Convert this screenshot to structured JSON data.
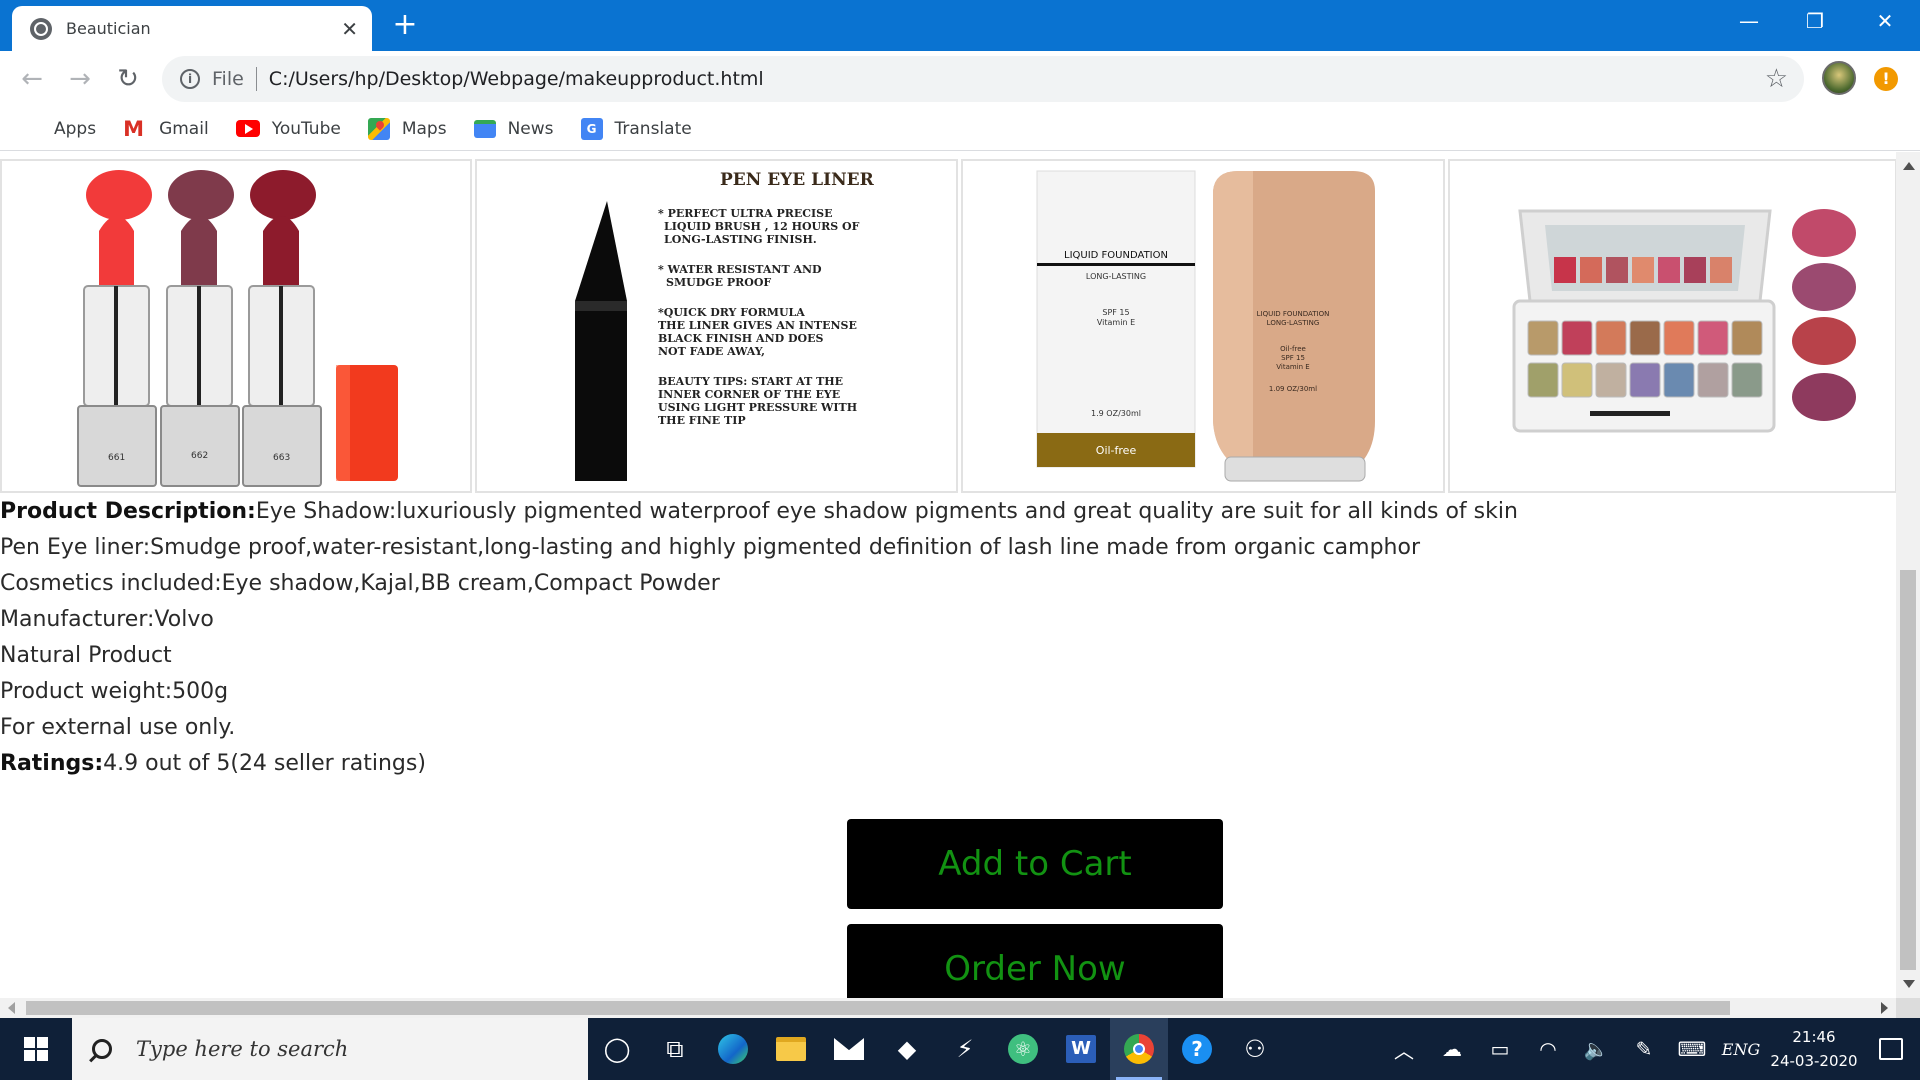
{
  "browser": {
    "tab_title": "Beautician",
    "tab_close": "✕",
    "new_tab": "+",
    "window_controls": {
      "minimize": "—",
      "restore": "❐",
      "close": "✕"
    },
    "nav": {
      "back": "←",
      "forward": "→",
      "reload": "↻"
    },
    "omnibox": {
      "info": "i",
      "scheme_label": "File",
      "url": "C:/Users/hp/Desktop/Webpage/makeupproduct.html",
      "star": "☆"
    },
    "alert": "!",
    "bookmarks": [
      {
        "label": "Apps",
        "icon": "apps-grid-icon"
      },
      {
        "label": "Gmail",
        "icon": "gmail-icon"
      },
      {
        "label": "YouTube",
        "icon": "youtube-icon"
      },
      {
        "label": "Maps",
        "icon": "maps-icon"
      },
      {
        "label": "News",
        "icon": "news-icon"
      },
      {
        "label": "Translate",
        "icon": "translate-icon"
      }
    ]
  },
  "products": {
    "lipsticks": {
      "shades": [
        "661",
        "662",
        "663"
      ],
      "colors": [
        "#f23a3a",
        "#7f3a4b",
        "#8d1b2c"
      ]
    },
    "eyeliner": {
      "title": "PEN EYE LINER",
      "points": [
        "* PERFECT ULTRA PRECISE",
        "LIQUID BRUSH , 12 HOURS OF",
        "LONG-LASTING FINISH.",
        "* WATER RESISTANT AND",
        "SMUDGE PROOF",
        "*QUICK DRY FORMULA",
        "THE LINER GIVES AN INTENSE",
        "BLACK FINISH AND DOES",
        "NOT FADE AWAY,",
        "BEAUTY TIPS: START AT THE",
        "INNER CORNER OF THE EYE",
        "USING LIGHT PRESSURE WITH",
        "THE FINE TIP"
      ]
    },
    "foundation": {
      "box_title": "LIQUID FOUNDATION",
      "box_sub": "LONG-LASTING",
      "box_spf": "SPF 15",
      "box_vit": "Vitamin E",
      "box_size": "1.9 OZ/30ml",
      "box_band": "Oil-free",
      "tube_title": "LIQUID FOUNDATION",
      "tube_sub": "LONG-LASTING",
      "tube_l1": "Oil-free",
      "tube_l2": "SPF 15",
      "tube_l3": "Vitamin E",
      "tube_size": "1.09 OZ/30ml"
    }
  },
  "description": {
    "label": "Product Description:",
    "eyeshadow": "Eye Shadow:luxuriously pigmented waterproof eye shadow pigments and great quality are suit for all kinds of skin",
    "eyeliner": "Pen Eye liner:Smudge proof,water-resistant,long-lasting and highly pigmented definition of lash line made from organic camphor",
    "cosmetics": "Cosmetics included:Eye shadow,Kajal,BB cream,Compact Powder",
    "manufacturer": "Manufacturer:Volvo",
    "natural": "Natural Product",
    "weight": "Product weight:500g",
    "external": "For external use only.",
    "ratings_label": "Ratings:",
    "ratings_value": "4.9 out of 5(24 seller ratings)"
  },
  "actions": {
    "add_to_cart": "Add to Cart",
    "order_now": "Order Now"
  },
  "taskbar": {
    "search_placeholder": "Type here to search",
    "lang": "ENG",
    "time": "21:46",
    "date": "24-03-2020"
  },
  "colors": {
    "accent_blue": "#0a73d1",
    "button_text_green": "#129212",
    "taskbar": "#0f2038"
  }
}
